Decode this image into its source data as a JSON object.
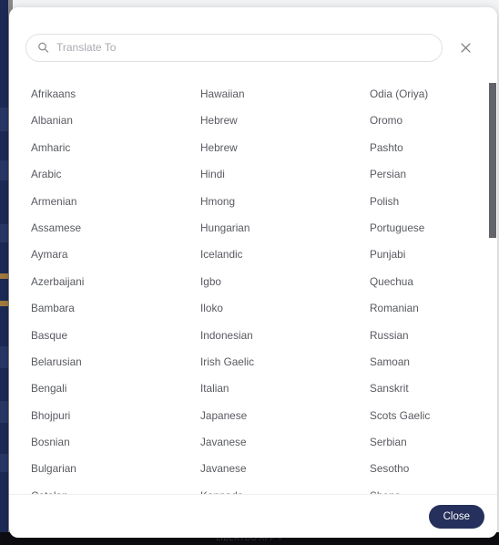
{
  "background": {
    "footer_text": "LIBERTOO APP +"
  },
  "dialog": {
    "search": {
      "placeholder": "Translate To",
      "value": "",
      "icon": "search-icon"
    },
    "close_icon": "close-icon",
    "footer": {
      "close_label": "Close"
    },
    "colors": {
      "button_background": "#26305c",
      "button_text": "#ffffff",
      "sidebar": "#1c2a55",
      "text": "#585a60",
      "placeholder": "#a9aab0",
      "border": "#e0e1e4"
    },
    "languages": {
      "columns": [
        [
          "Afrikaans",
          "Albanian",
          "Amharic",
          "Arabic",
          "Armenian",
          "Assamese",
          "Aymara",
          "Azerbaijani",
          "Bambara",
          "Basque",
          "Belarusian",
          "Bengali",
          "Bhojpuri",
          "Bosnian",
          "Bulgarian",
          "Catalan"
        ],
        [
          "Hawaiian",
          "Hebrew",
          "Hebrew",
          "Hindi",
          "Hmong",
          "Hungarian",
          "Icelandic",
          "Igbo",
          "Iloko",
          "Indonesian",
          "Irish Gaelic",
          "Italian",
          "Japanese",
          "Javanese",
          "Javanese",
          "Kannada"
        ],
        [
          "Odia (Oriya)",
          "Oromo",
          "Pashto",
          "Persian",
          "Polish",
          "Portuguese",
          "Punjabi",
          "Quechua",
          "Romanian",
          "Russian",
          "Samoan",
          "Sanskrit",
          "Scots Gaelic",
          "Serbian",
          "Sesotho",
          "Shona"
        ]
      ]
    }
  }
}
